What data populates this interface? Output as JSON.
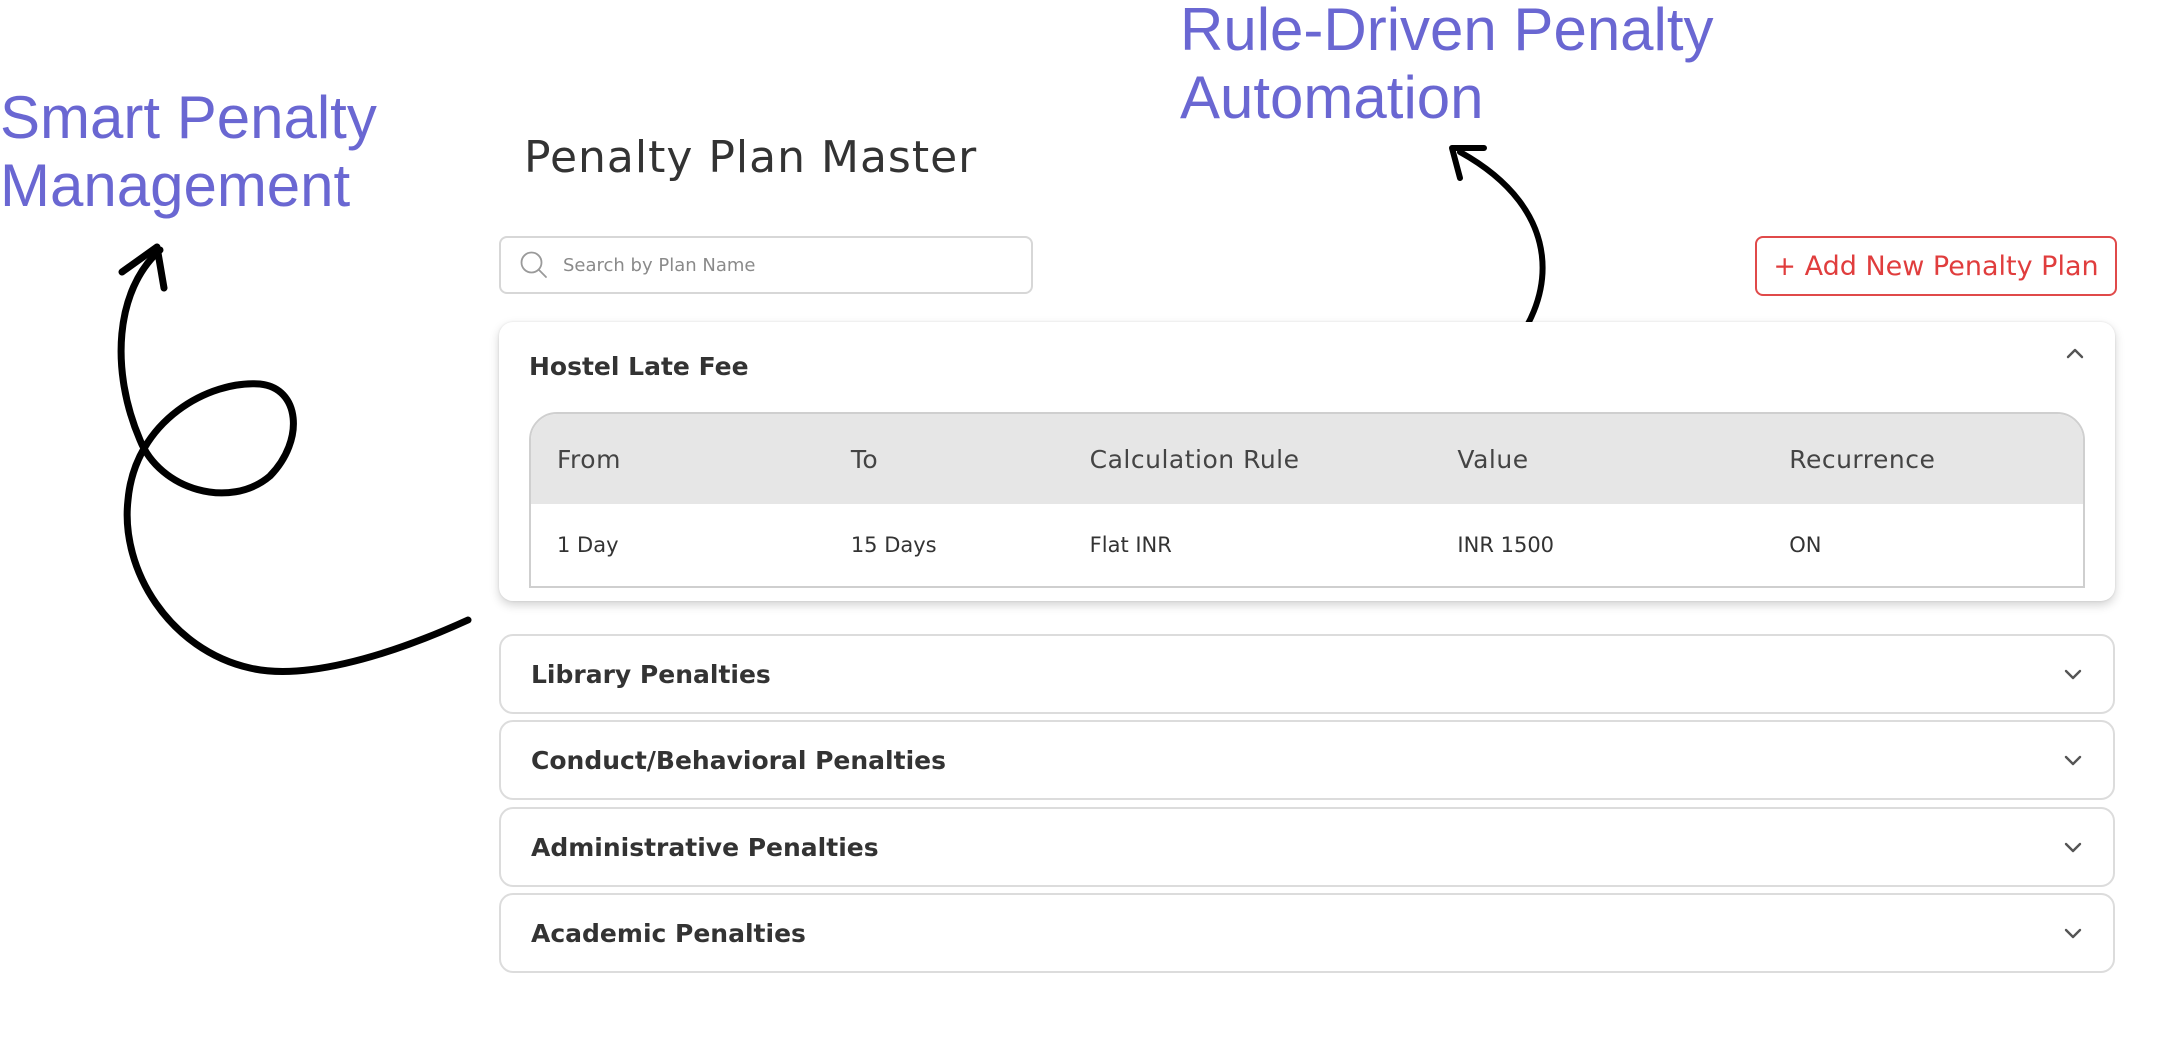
{
  "callouts": {
    "left": "Smart Penalty Management",
    "right": "Rule-Driven Penalty Automation"
  },
  "colors": {
    "callout": "#6a67d2",
    "accent_red": "#e03d3d",
    "table_header_bg": "#e6e6e6"
  },
  "page": {
    "title": "Penalty Plan Master"
  },
  "search": {
    "placeholder": "Search by Plan Name",
    "value": "",
    "icon": "search-icon"
  },
  "actions": {
    "add_label": "+ Add New Penalty Plan"
  },
  "plans": [
    {
      "name": "Hostel Late Fee",
      "expanded": true,
      "icon": "chevron-up-icon",
      "columns": [
        "From",
        "To",
        "Calculation Rule",
        "Value",
        "Recurrence"
      ],
      "rows": [
        [
          "1 Day",
          "15 Days",
          "Flat INR",
          "INR 1500",
          "ON"
        ]
      ]
    },
    {
      "name": "Library Penalties",
      "expanded": false,
      "icon": "chevron-down-icon"
    },
    {
      "name": "Conduct/Behavioral Penalties",
      "expanded": false,
      "icon": "chevron-down-icon"
    },
    {
      "name": "Administrative Penalties",
      "expanded": false,
      "icon": "chevron-down-icon"
    },
    {
      "name": "Academic Penalties",
      "expanded": false,
      "icon": "chevron-down-icon"
    }
  ]
}
